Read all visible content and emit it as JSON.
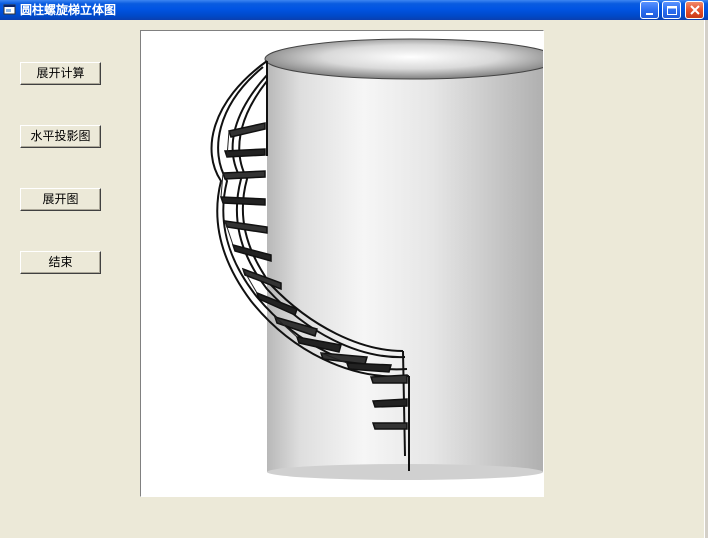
{
  "window": {
    "title": "圆柱螺旋梯立体图"
  },
  "buttons": {
    "unfold_calc": "展开计算",
    "plan_view": "水平投影图",
    "unfold_view": "展开图",
    "finish": "结束"
  },
  "image": {
    "subject": "3D perspective drawing of a spiral staircase wrapping around a cylinder"
  },
  "colors": {
    "titlebar": "#0054e3",
    "face": "#ece9d8",
    "picture_bg": "#ffffff"
  }
}
